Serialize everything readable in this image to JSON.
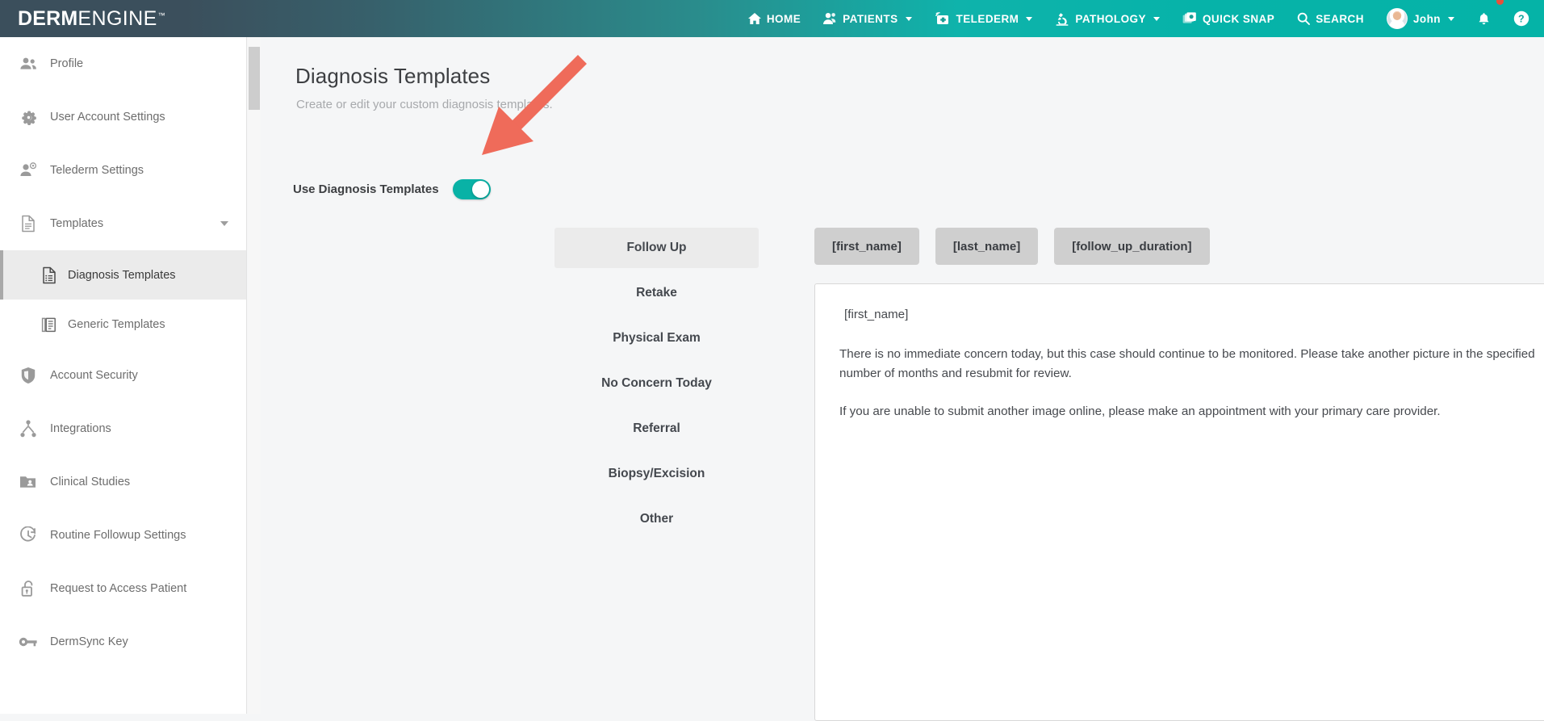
{
  "brand": {
    "bold": "DERM",
    "light": "ENGINE",
    "tm": "™"
  },
  "topnav": {
    "items": [
      {
        "label": "HOME",
        "icon": "home-icon",
        "caret": false
      },
      {
        "label": "PATIENTS",
        "icon": "patients-icon",
        "caret": true
      },
      {
        "label": "TELEDERM",
        "icon": "telederm-icon",
        "caret": true
      },
      {
        "label": "PATHOLOGY",
        "icon": "microscope-icon",
        "caret": true
      },
      {
        "label": "QUICK SNAP",
        "icon": "photos-icon",
        "caret": false
      },
      {
        "label": "SEARCH",
        "icon": "search-icon",
        "caret": false
      }
    ],
    "user": {
      "label": "John",
      "icon": "avatar",
      "caret": true
    },
    "notifications": {
      "icon": "bell-icon",
      "badge": true
    },
    "help": {
      "icon": "help-icon"
    }
  },
  "sidebar": {
    "items": [
      {
        "label": "Profile",
        "icon": "people-icon",
        "level": "top",
        "active": false,
        "caret": false
      },
      {
        "label": "User Account Settings",
        "icon": "gear-icon",
        "level": "top",
        "active": false,
        "caret": false
      },
      {
        "label": "Telederm Settings",
        "icon": "user-settings-icon",
        "level": "top",
        "active": false,
        "caret": false
      },
      {
        "label": "Templates",
        "icon": "document-icon",
        "level": "top",
        "active": false,
        "caret": true
      },
      {
        "label": "Diagnosis Templates",
        "icon": "document-list-icon",
        "level": "sub",
        "active": true,
        "caret": false
      },
      {
        "label": "Generic Templates",
        "icon": "documents-copy-icon",
        "level": "sub",
        "active": false,
        "caret": false
      },
      {
        "label": "Account Security",
        "icon": "shield-icon",
        "level": "top",
        "active": false,
        "caret": false
      },
      {
        "label": "Integrations",
        "icon": "integrations-icon",
        "level": "top",
        "active": false,
        "caret": false
      },
      {
        "label": "Clinical Studies",
        "icon": "folder-user-icon",
        "level": "top",
        "active": false,
        "caret": false
      },
      {
        "label": "Routine Followup Settings",
        "icon": "clock-refresh-icon",
        "level": "top",
        "active": false,
        "caret": false
      },
      {
        "label": "Request to Access Patient",
        "icon": "unlock-icon",
        "level": "top",
        "active": false,
        "caret": false
      },
      {
        "label": "DermSync Key",
        "icon": "key-icon",
        "level": "top",
        "active": false,
        "caret": false
      }
    ]
  },
  "main": {
    "title": "Diagnosis Templates",
    "subtitle": "Create or edit your custom diagnosis templates.",
    "toggle": {
      "label": "Use Diagnosis Templates",
      "on": true
    }
  },
  "templates": {
    "items": [
      {
        "label": "Follow Up",
        "selected": true
      },
      {
        "label": "Retake",
        "selected": false
      },
      {
        "label": "Physical Exam",
        "selected": false
      },
      {
        "label": "No Concern Today",
        "selected": false
      },
      {
        "label": "Referral",
        "selected": false
      },
      {
        "label": "Biopsy/Excision",
        "selected": false
      },
      {
        "label": "Other",
        "selected": false
      }
    ]
  },
  "placeholders": {
    "chips": [
      {
        "label": "[first_name]"
      },
      {
        "label": "[last_name]"
      },
      {
        "label": "[follow_up_duration]"
      }
    ]
  },
  "editor": {
    "greeting": "[first_name]",
    "paragraph1": "There is no immediate concern today, but this case should continue to be monitored. Please take another picture in the specified number of months and resubmit for review.",
    "paragraph2": "If you are unable to submit another image online, please make an appointment with your primary care provider."
  },
  "colors": {
    "accent_teal": "#09b2a6",
    "nav_dark": "#3b4f5c",
    "annotation_red": "#ef6b5a",
    "page_bg": "#f5f6f7",
    "chip_gray": "#cfcfcf"
  }
}
